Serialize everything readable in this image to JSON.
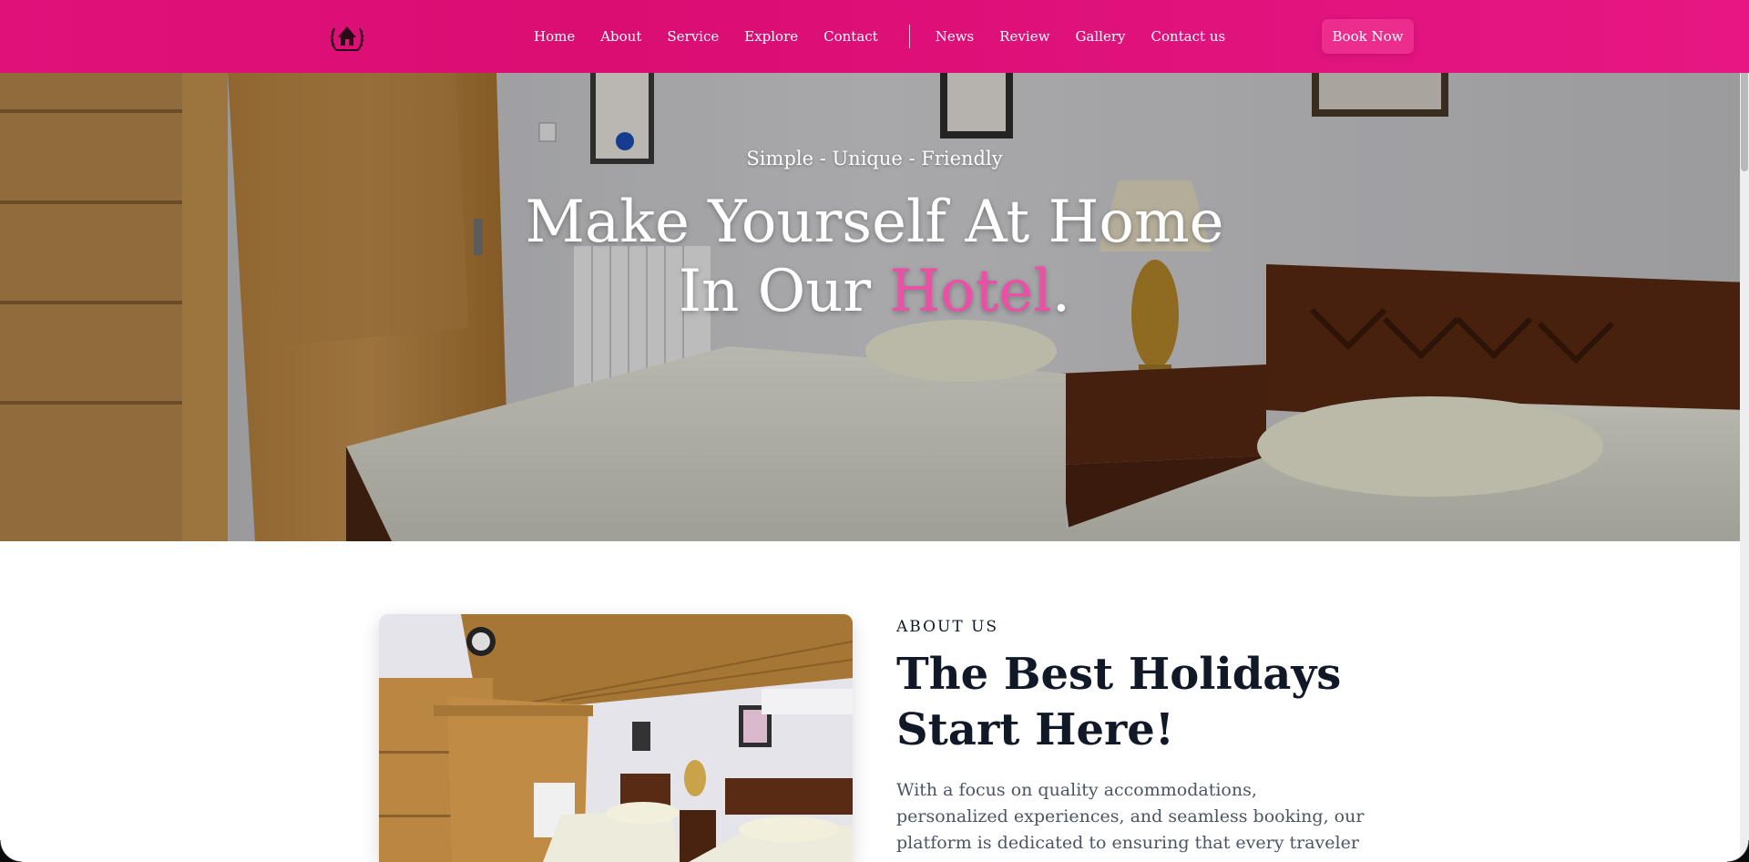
{
  "nav": {
    "logo_icon": "hotel-logo-icon",
    "links_primary": [
      "Home",
      "About",
      "Service",
      "Explore",
      "Contact"
    ],
    "links_secondary": [
      "News",
      "Review",
      "Gallery",
      "Contact us"
    ],
    "cta": "Book Now",
    "colors": {
      "bar": "#df127a",
      "button": "#ec2d8e"
    }
  },
  "hero": {
    "tagline": "Simple - Unique - Friendly",
    "title_line1": "Make Yourself At Home",
    "title_line2_prefix": "In Our ",
    "title_accent": "Hotel",
    "title_suffix": ".",
    "accent_color": "#ec4fa6"
  },
  "about": {
    "eyebrow": "ABOUT US",
    "title": "The Best Holidays Start Here!",
    "description": "With a focus on quality accommodations, personalized experiences, and seamless booking, our platform is dedicated to ensuring that every traveler embarks on their"
  }
}
